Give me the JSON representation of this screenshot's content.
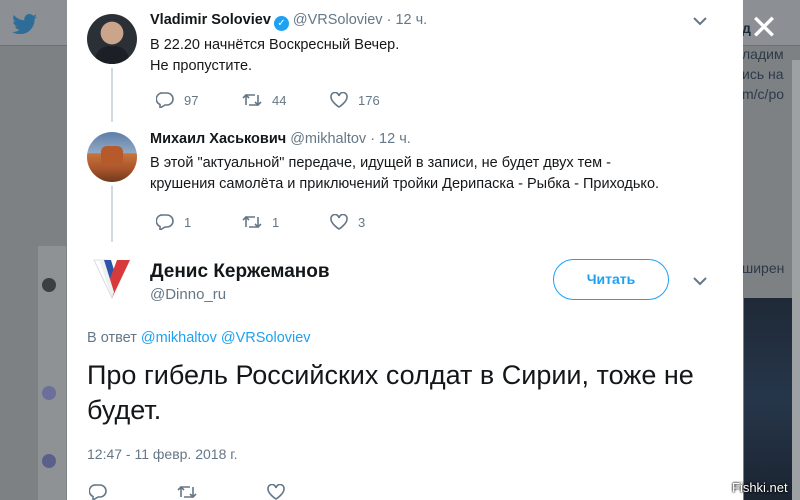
{
  "background": {
    "right_lines": [
      "д",
      "ладим",
      "ись на",
      "m/c/ро",
      "ширен"
    ]
  },
  "thread": [
    {
      "name": "Vladimir Soloviev",
      "verified": true,
      "handle": "@VRSoloviev",
      "time": "· 12 ч.",
      "text_lines": [
        "В 22.20 начнётся Воскресный Вечер.",
        "Не пропустите."
      ],
      "replies": "97",
      "retweets": "44",
      "likes": "176"
    },
    {
      "name": "Михаил Хаськович",
      "verified": false,
      "handle": "@mikhaltov",
      "time": "· 12 ч.",
      "text_lines": [
        "В этой \"актуальной\" передаче, идущей в записи, не будет двух тем -",
        "крушения самолёта и приключений тройки Дерипаска - Рыбка - Приходько."
      ],
      "replies": "1",
      "retweets": "1",
      "likes": "3"
    }
  ],
  "main_tweet": {
    "name": "Денис Кержеманов",
    "handle": "@Dinno_ru",
    "follow_label": "Читать",
    "reply_prefix": "В ответ",
    "reply_mentions": [
      "@mikhaltov",
      "@VRSoloviev"
    ],
    "text": "Про гибель Российских солдат в Сирии, тоже не будет.",
    "timestamp": "12:47 - 11 февр. 2018 г."
  },
  "close_icon": "✕",
  "watermark": "Fishki.net",
  "colors": {
    "accent": "#1da1f2",
    "text": "#14171a",
    "muted": "#657786",
    "overlay": "#7d8184"
  },
  "icons": [
    "twitter-bird-icon",
    "verified-badge-icon",
    "chevron-down-icon",
    "reply-icon",
    "retweet-icon",
    "like-icon",
    "close-icon"
  ]
}
